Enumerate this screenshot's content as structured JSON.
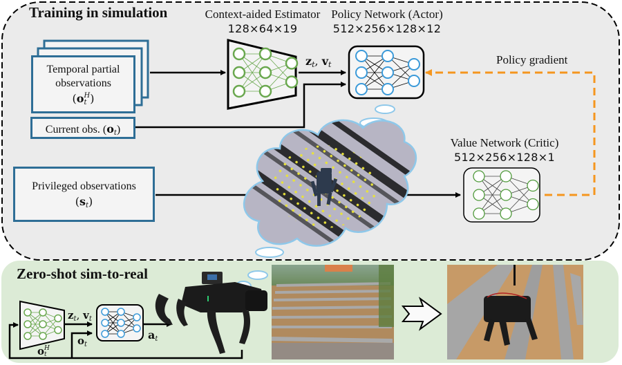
{
  "colors": {
    "sim_panel_bg": "#ebebeb",
    "real_panel_bg": "#dcebd6",
    "obs_box_border": "#2e6e96",
    "estimator_node": "#6aa84f",
    "actor_node": "#3b9ad9",
    "critic_node": "#4f9a3a",
    "policy_gradient_arrow": "#f5961e",
    "cloud_border": "#8ec8ea"
  },
  "sim_panel": {
    "title": "Training in simulation",
    "temporal_obs": {
      "line1": "Temporal partial",
      "line2": "observations",
      "symbol": "(o",
      "sub": "t",
      "sup": "H",
      "close": ")"
    },
    "current_obs": {
      "label": "Current obs. (",
      "symbol": "o",
      "sub": "t",
      "close": ")"
    },
    "privileged_obs": {
      "line1": "Privileged observations",
      "symbol": "(s",
      "sub": "t",
      "close": ")"
    },
    "estimator": {
      "title": "Context-aided Estimator",
      "dims": "128×64×19"
    },
    "actor": {
      "title": "Policy Network (Actor)",
      "dims": "512×256×128×12"
    },
    "critic": {
      "title": "Value Network (Critic)",
      "dims": "512×256×128×1"
    },
    "estimator_output": {
      "z": "z",
      "v": "v",
      "sub": "t",
      "sep": ", "
    },
    "policy_gradient_label": "Policy gradient",
    "simulation_scene": "simulated quadruped on stair terrain with height-scan points"
  },
  "real_panel": {
    "title": "Zero-shot sim-to-real",
    "estimator_input": {
      "symbol": "o",
      "sub": "t",
      "sup": "H"
    },
    "estimator_output": {
      "z": "z",
      "v": "v",
      "sub": "t",
      "sep": ", "
    },
    "current_obs": {
      "symbol": "o",
      "sub": "t"
    },
    "action": {
      "symbol": "a",
      "sub": "t"
    },
    "robot_photo": "real quadruped robot",
    "stairs_photo": "outdoor stone stairs",
    "result_photo": "robot climbing outdoor stairs"
  }
}
